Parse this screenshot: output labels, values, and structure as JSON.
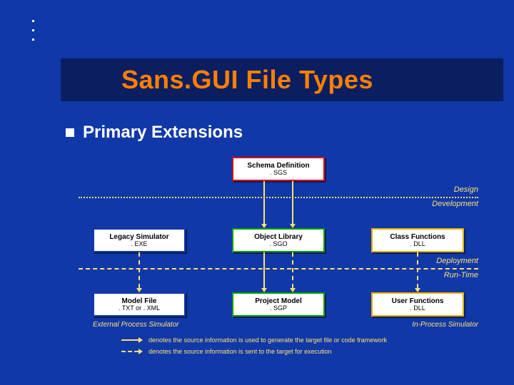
{
  "title": "Sans.GUI File Types",
  "subtitle": "Primary Extensions",
  "phases": {
    "design": "Design",
    "development": "Development",
    "deployment": "Deployment",
    "runtime": "Run-Time"
  },
  "boxes": {
    "schema": {
      "title": "Schema Definition",
      "ext": ". SGS"
    },
    "legacy": {
      "title": "Legacy Simulator",
      "ext": ". EXE"
    },
    "objlib": {
      "title": "Object Library",
      "ext": ". SGO"
    },
    "classfn": {
      "title": "Class Functions",
      "ext": ". DLL"
    },
    "modelf": {
      "title": "Model File",
      "ext": ". TXT or . XML"
    },
    "project": {
      "title": "Project Model",
      "ext": ". SGP"
    },
    "userfn": {
      "title": "User Functions",
      "ext": ". DLL"
    }
  },
  "simlabels": {
    "external": "External Process Simulator",
    "inproc": "In-Process Simulator"
  },
  "legend": {
    "solid": "denotes the source information is used to generate the target file or code framework",
    "dashed": "denotes the source information is sent to the target for execution"
  }
}
